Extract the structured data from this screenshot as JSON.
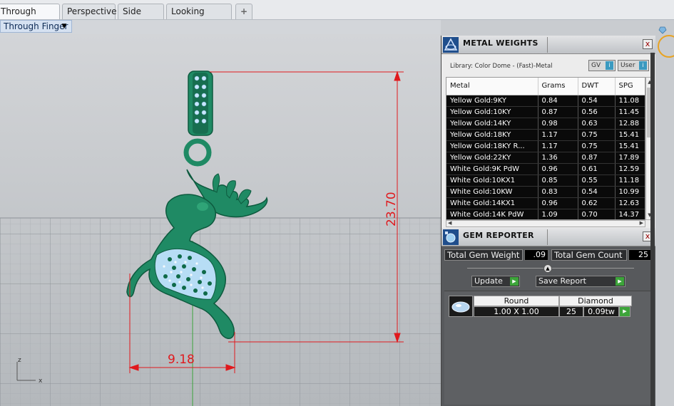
{
  "tabs": [
    {
      "label": "Through Finger",
      "active": true
    },
    {
      "label": "Perspective",
      "active": false
    },
    {
      "label": "Side View",
      "active": false
    },
    {
      "label": "Looking Down",
      "active": false
    }
  ],
  "add_tab_icon": "plus-icon",
  "viewport": {
    "label": "Through Finger",
    "dimension_height": "23.70",
    "dimension_width": "9.18",
    "axis_z": "z",
    "axis_x": "x"
  },
  "metal_weights": {
    "title": "METAL WEIGHTS",
    "library": "Library: Color Dome - (Fast)-Metal",
    "gv_label": "GV",
    "user_label": "User",
    "close": "x",
    "columns": [
      "Metal",
      "Grams",
      "DWT",
      "SPG"
    ],
    "rows": [
      [
        "Yellow Gold:9KY",
        "0.84",
        "0.54",
        "11.08"
      ],
      [
        "Yellow Gold:10KY",
        "0.87",
        "0.56",
        "11.45"
      ],
      [
        "Yellow Gold:14KY",
        "0.98",
        "0.63",
        "12.88"
      ],
      [
        "Yellow Gold:18KY",
        "1.17",
        "0.75",
        "15.41"
      ],
      [
        "Yellow Gold:18KY R...",
        "1.17",
        "0.75",
        "15.41"
      ],
      [
        "Yellow Gold:22KY",
        "1.36",
        "0.87",
        "17.89"
      ],
      [
        "White Gold:9K PdW",
        "0.96",
        "0.61",
        "12.59"
      ],
      [
        "White Gold:10KX1",
        "0.85",
        "0.55",
        "11.18"
      ],
      [
        "White Gold:10KW",
        "0.83",
        "0.54",
        "10.99"
      ],
      [
        "White Gold:14KX1",
        "0.96",
        "0.62",
        "12.63"
      ],
      [
        "White Gold:14K PdW",
        "1.09",
        "0.70",
        "14.37"
      ]
    ]
  },
  "gem_reporter": {
    "title": "GEM REPORTER",
    "close": "x",
    "total_weight_label": "Total Gem Weight",
    "total_weight_value": ".09",
    "total_count_label": "Total Gem Count",
    "total_count_value": "25",
    "update_label": "Update",
    "save_label": "Save Report",
    "result": {
      "shape": "Round",
      "material": "Diamond",
      "size": "1.00 X 1.00",
      "count": "25",
      "weight": "0.09tw"
    }
  },
  "colors": {
    "model_green": "#1f8a64",
    "dimension_red": "#e0191d",
    "gem_blue": "#c8e6ff",
    "grid": "#9ea4aa"
  }
}
